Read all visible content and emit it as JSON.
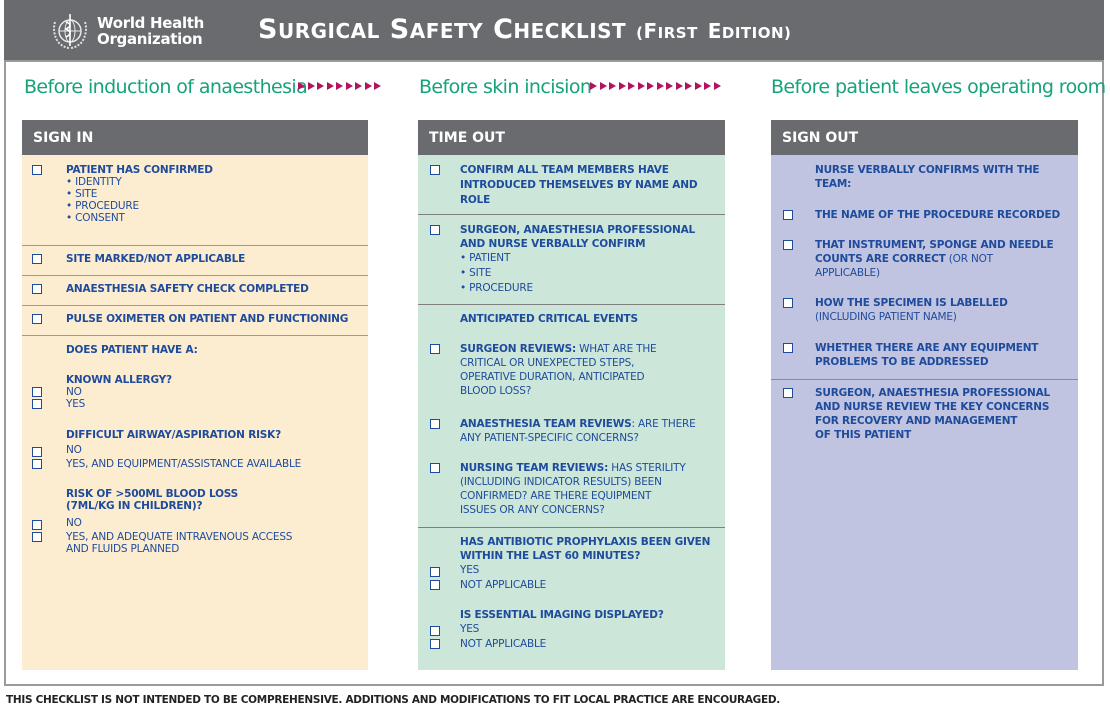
{
  "header": {
    "org_line1": "World Health",
    "org_line2": "Organization",
    "title_main": "SURGICAL SAFETY CHECKLIST",
    "title_edition": "(FIRST EDITION)",
    "logo_icon": "who-emblem-icon"
  },
  "phases": {
    "phase1": "Before induction of anaesthesia",
    "phase2": "Before skin incision",
    "phase3": "Before patient leaves operating room",
    "arrow_color": "#b0145e",
    "arrows_group1": 9,
    "arrows_group2": 14
  },
  "sign_in": {
    "title": "SIGN IN",
    "item1": {
      "label": "PATIENT HAS CONFIRMED",
      "bullets": [
        "• IDENTITY",
        "• SITE",
        "• PROCEDURE",
        "• CONSENT"
      ]
    },
    "item2": "SITE MARKED/NOT APPLICABLE",
    "item3": "ANAESTHESIA SAFETY CHECK COMPLETED",
    "item4": "PULSE OXIMETER ON PATIENT AND FUNCTIONING",
    "q_intro": "DOES PATIENT HAVE A:",
    "q1": {
      "label": "KNOWN ALLERGY?",
      "opt1": "NO",
      "opt2": "YES"
    },
    "q2": {
      "label": "DIFFICULT AIRWAY/ASPIRATION RISK?",
      "opt1": "NO",
      "opt2": "YES, AND EQUIPMENT/ASSISTANCE AVAILABLE"
    },
    "q3": {
      "label1": "RISK OF >500ML BLOOD LOSS",
      "label2": "(7ML/KG IN CHILDREN)?",
      "opt1": "NO",
      "opt2a": "YES, AND ADEQUATE INTRAVENOUS ACCESS",
      "opt2b": "AND FLUIDS PLANNED"
    }
  },
  "time_out": {
    "title": "TIME OUT",
    "item1": [
      "CONFIRM ALL TEAM MEMBERS HAVE",
      "INTRODUCED THEMSELVES BY NAME AND",
      "ROLE"
    ],
    "item2": {
      "lines": [
        "SURGEON, ANAESTHESIA PROFESSIONAL",
        "AND NURSE VERBALLY CONFIRM"
      ],
      "bullets": [
        "• PATIENT",
        "• SITE",
        "• PROCEDURE"
      ]
    },
    "ace_title": "ANTICIPATED CRITICAL EVENTS",
    "surgeon": {
      "bold": "SURGEON REVIEWS:",
      "line1": " WHAT ARE THE",
      "line2": "CRITICAL OR UNEXPECTED STEPS,",
      "line3": "OPERATIVE DURATION, ANTICIPATED",
      "line4": "BLOOD LOSS?"
    },
    "anaesthesia": {
      "bold": "ANAESTHESIA TEAM REVIEWS",
      "line1": ": ARE THERE",
      "line2": "ANY PATIENT-SPECIFIC CONCERNS?"
    },
    "nursing": {
      "bold": "NURSING TEAM REVIEWS:",
      "line1": " HAS STERILITY",
      "line2": "(INCLUDING INDICATOR RESULTS) BEEN",
      "line3": "CONFIRMED? ARE THERE EQUIPMENT",
      "line4": "ISSUES OR ANY CONCERNS?"
    },
    "antibiotic": {
      "label1": "HAS ANTIBIOTIC PROPHYLAXIS BEEN GIVEN",
      "label2": "WITHIN THE LAST 60 MINUTES?",
      "opt1": "YES",
      "opt2": "NOT APPLICABLE"
    },
    "imaging": {
      "label": "IS ESSENTIAL IMAGING DISPLAYED?",
      "opt1": "YES",
      "opt2": "NOT APPLICABLE"
    }
  },
  "sign_out": {
    "title": "SIGN OUT",
    "intro1": "NURSE VERBALLY CONFIRMS WITH THE",
    "intro2": "TEAM:",
    "item1": "THE NAME OF THE PROCEDURE RECORDED",
    "item2": {
      "line1": "THAT INSTRUMENT, SPONGE AND NEEDLE",
      "line2_bold": "COUNTS ARE CORRECT",
      "line2_normal": " (OR NOT",
      "line3": "APPLICABLE)"
    },
    "item3": {
      "line1": "HOW THE SPECIMEN IS LABELLED",
      "line2": "(INCLUDING PATIENT NAME)"
    },
    "item4": {
      "line1": "WHETHER THERE ARE ANY EQUIPMENT",
      "line2": "PROBLEMS TO BE ADDRESSED"
    },
    "item5": [
      "SURGEON, ANAESTHESIA PROFESSIONAL",
      "AND NURSE REVIEW THE KEY CONCERNS",
      "FOR RECOVERY AND MANAGEMENT",
      "OF THIS PATIENT"
    ]
  },
  "footer": "THIS CHECKLIST IS NOT INTENDED TO BE COMPREHENSIVE. ADDITIONS AND MODIFICATIONS TO FIT LOCAL PRACTICE ARE ENCOURAGED.",
  "colors": {
    "header_bg": "#6a6b6f",
    "phase_text": "#16a37a",
    "item_text": "#1e4b9c",
    "sign_in_bg": "#fdedd0",
    "time_out_bg": "#cce6da",
    "sign_out_bg": "#c0c4e0"
  }
}
